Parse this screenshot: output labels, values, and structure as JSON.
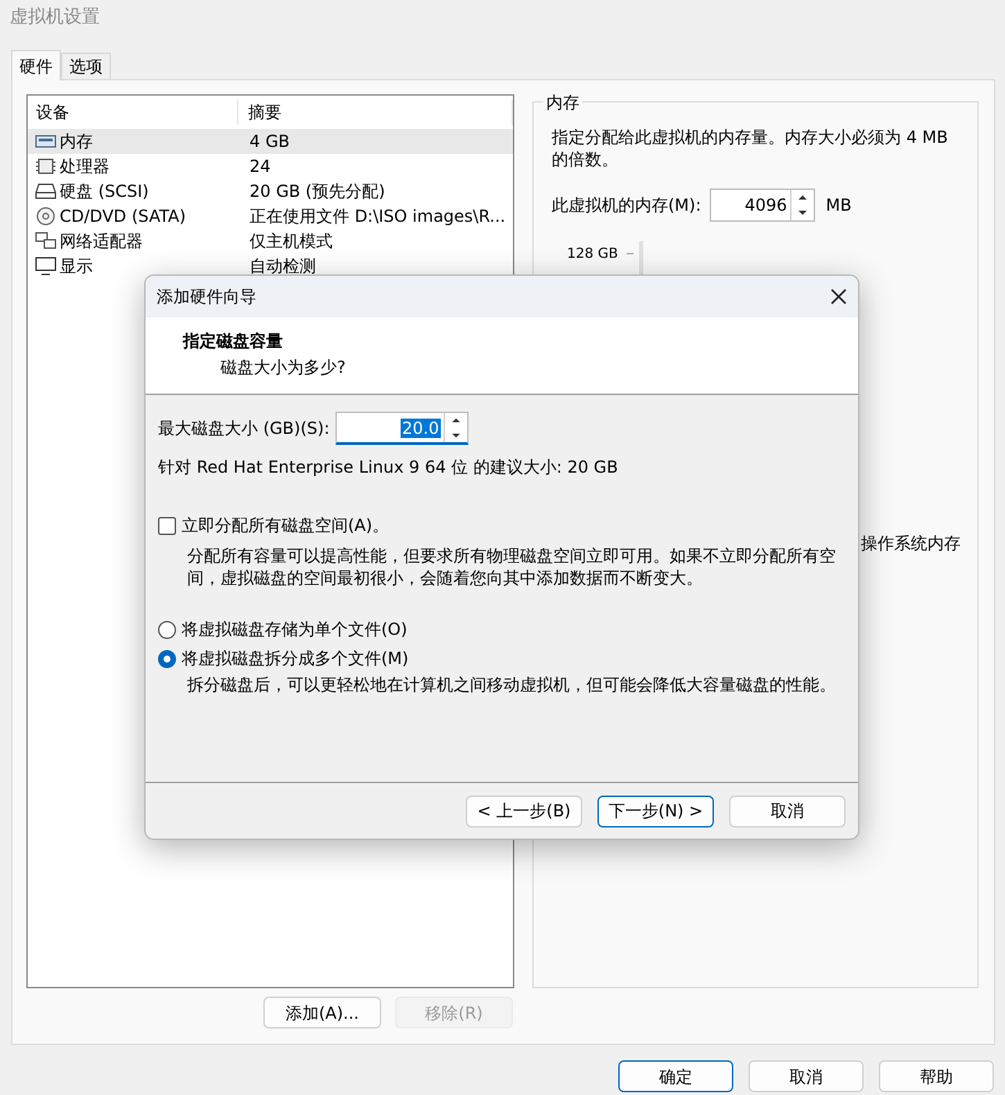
{
  "window": {
    "title": "虚拟机设置"
  },
  "tabs": [
    {
      "label": "硬件",
      "selected": true
    },
    {
      "label": "选项",
      "selected": false
    }
  ],
  "device_table": {
    "columns": [
      "设备",
      "摘要"
    ],
    "rows": [
      {
        "kind": "memory",
        "device": "内存",
        "summary": "4 GB",
        "selected": true
      },
      {
        "kind": "cpu",
        "device": "处理器",
        "summary": "24",
        "selected": false
      },
      {
        "kind": "disk",
        "device": "硬盘 (SCSI)",
        "summary": "20 GB (预先分配)",
        "selected": false
      },
      {
        "kind": "cd",
        "device": "CD/DVD (SATA)",
        "summary": "正在使用文件 D:\\ISO images\\R...",
        "selected": false
      },
      {
        "kind": "network",
        "device": "网络适配器",
        "summary": "仅主机模式",
        "selected": false
      },
      {
        "kind": "display",
        "device": "显示",
        "summary": "自动检测",
        "selected": false
      }
    ]
  },
  "device_buttons": [
    {
      "label": "添加(A)...",
      "disabled": false
    },
    {
      "label": "移除(R)",
      "disabled": true
    }
  ],
  "memory_panel": {
    "title": "内存",
    "description": "指定分配给此虚拟机的内存量。内存大小必须为 4 MB 的倍数。",
    "field_label": "此虚拟机的内存(M):",
    "value": "4096",
    "unit": "MB",
    "slider_label": "128 GB",
    "note": "操作系统内存"
  },
  "dialog": {
    "title": "添加硬件向导",
    "heading": "指定磁盘容量",
    "subheading": "磁盘大小为多少?",
    "size_label": "最大磁盘大小 (GB)(S):",
    "size_value": "20.0",
    "recommendation": "针对 Red Hat Enterprise Linux 9 64 位 的建议大小: 20 GB",
    "allocate": {
      "label": "立即分配所有磁盘空间(A)。",
      "checked": false,
      "description": "分配所有容量可以提高性能，但要求所有物理磁盘空间立即可用。如果不立即分配所有空间，虚拟磁盘的空间最初很小，会随着您向其中添加数据而不断变大。"
    },
    "storage_options": [
      {
        "label": "将虚拟磁盘存储为单个文件(O)",
        "selected": false
      },
      {
        "label": "将虚拟磁盘拆分成多个文件(M)",
        "selected": true
      }
    ],
    "split_description": "拆分磁盘后，可以更轻松地在计算机之间移动虚拟机，但可能会降低大容量磁盘的性能。",
    "buttons": [
      {
        "label": "< 上一步(B)",
        "default": false
      },
      {
        "label": "下一步(N) >",
        "default": true
      },
      {
        "label": "取消",
        "default": false
      }
    ]
  },
  "footer_buttons": [
    {
      "label": "确定",
      "default": true
    },
    {
      "label": "取消",
      "default": false
    },
    {
      "label": "帮助",
      "default": false
    }
  ]
}
